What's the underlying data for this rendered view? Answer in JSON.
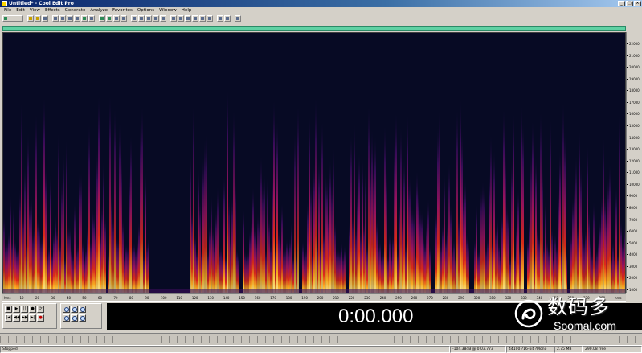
{
  "window": {
    "title": "Untitled* - Cool Edit Pro"
  },
  "window_buttons": {
    "minimize": "_",
    "maximize": "□",
    "close": "×"
  },
  "menu": [
    "File",
    "Edit",
    "View",
    "Effects",
    "Generate",
    "Analyze",
    "Favorites",
    "Options",
    "Window",
    "Help"
  ],
  "transport": {
    "row1": [
      "■",
      "▶",
      "||",
      "●",
      "⟳"
    ],
    "row2": [
      "|◀",
      "◀◀",
      "▶▶",
      "▶|",
      "●"
    ]
  },
  "time_display": "0:00.000",
  "frequency_ruler": [
    "22000",
    "21000",
    "20000",
    "19000",
    "18000",
    "17000",
    "16000",
    "15000",
    "14000",
    "13000",
    "12000",
    "11000",
    "10000",
    "9000",
    "8000",
    "7000",
    "6000",
    "5000",
    "4000",
    "3000",
    "2000",
    "1000"
  ],
  "time_ruler": [
    "hms",
    "10",
    "20",
    "30",
    "40",
    "50",
    "60",
    "70",
    "80",
    "90",
    "100",
    "110",
    "120",
    "130",
    "140",
    "150",
    "160",
    "170",
    "180",
    "190",
    "200",
    "210",
    "220",
    "230",
    "240",
    "250",
    "260",
    "270",
    "280",
    "290",
    "300",
    "310",
    "320",
    "330",
    "340",
    "350",
    "360",
    "370",
    "380",
    "hms"
  ],
  "statusbar": {
    "state": "Stopped",
    "level": "-104.38dB @ 0:03.773",
    "format": "44100 ?16-bit ?Mono",
    "size": "2.75 MB",
    "free": "290.08 free"
  },
  "watermark": {
    "cn": "数码多",
    "en": "Soomal.com"
  },
  "colors": {
    "spectral_bg": "#070a24",
    "overview": "#5fd1a3",
    "hot": "#ffe066",
    "warm": "#e03020",
    "cool": "#6a1a8a"
  }
}
